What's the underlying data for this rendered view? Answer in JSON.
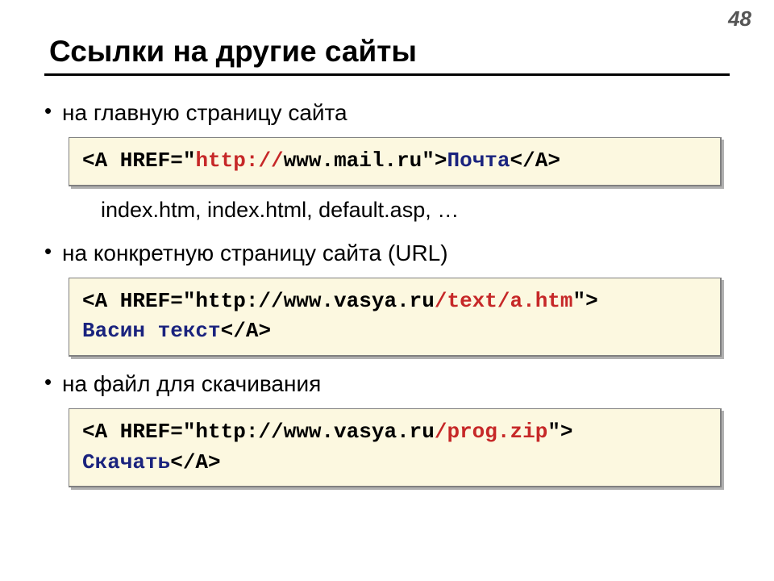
{
  "page_number": "48",
  "title": "Ссылки на другие сайты",
  "bullets": {
    "b1": "на главную страницу сайта",
    "b2": "на конкретную страницу сайта (URL)",
    "b3": "на файл для скачивания"
  },
  "subtext": "index.htm, index.html, default.asp, …",
  "code1": {
    "s1": "<A HREF=\"",
    "s2": "http://",
    "s3": "www.mail.ru\">",
    "s4": "Почта",
    "s5": "</A>"
  },
  "code2": {
    "s1": "<A HREF=\"http://www.vasya.ru",
    "s2": "/text/a.htm",
    "s3": "\">",
    "s4": "Васин текст",
    "s5": "</A>"
  },
  "code3": {
    "s1": "<A HREF=\"http://www.vasya.ru",
    "s2": "/prog.zip",
    "s3": "\">",
    "s4": "Скачать",
    "s5": "</A>"
  }
}
